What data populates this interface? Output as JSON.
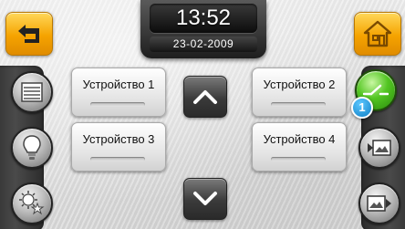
{
  "header": {
    "time": "13:52",
    "date": "23-02-2009"
  },
  "devices": [
    {
      "label": "Устройство 1"
    },
    {
      "label": "Устройство 2"
    },
    {
      "label": "Устройство 3"
    },
    {
      "label": "Устройство 4"
    }
  ],
  "right_panel": {
    "badge": "1"
  },
  "colors": {
    "accent_orange": "#f5a300",
    "active_green": "#52c521",
    "badge_blue": "#0e7fc6"
  },
  "icons": [
    "back-arrow-icon",
    "home-icon",
    "blinds-icon",
    "light-bulb-icon",
    "scene-icon",
    "switch-icon",
    "projector-screen-icon",
    "screen-forward-icon",
    "chevron-up-icon",
    "chevron-down-icon"
  ]
}
